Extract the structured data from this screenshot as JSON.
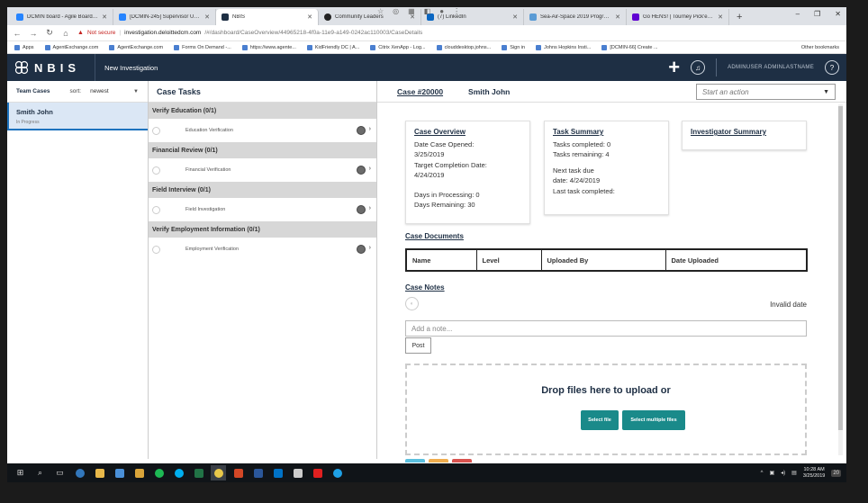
{
  "browser": {
    "tabs": [
      {
        "title": "DCMIN board - Agile Board - All...",
        "icon_color": "#2684ff"
      },
      {
        "title": "[DCMIN-245] Supervisor User To...",
        "icon_color": "#2684ff"
      },
      {
        "title": "NBIS",
        "icon_color": "#1e2f44",
        "active": true
      },
      {
        "title": "Community Leaders",
        "icon_color": "#222222"
      },
      {
        "title": "(7) LinkedIn",
        "icon_color": "#0a66c2"
      },
      {
        "title": "Sea-Air-Space 2019 Program - Sc...",
        "icon_color": "#5a9bd5"
      },
      {
        "title": "Go HENS! | Tourney Pick'em | Yo...",
        "icon_color": "#6001d2"
      }
    ],
    "new_tab": "+",
    "window_controls": {
      "minimize": "–",
      "maximize": "❐",
      "close": "✕"
    },
    "nav": {
      "back": "←",
      "forward": "→",
      "reload": "↻",
      "home": "⌂"
    },
    "security_label": "Not secure",
    "url_host": "investigation.deloittedcm.com",
    "url_path": "/#/dashboard/CaseOverview/44965218-4f0a-11e9-a149-0242ac110003/CaseDetails",
    "bookmarks": [
      "Apps",
      "AgentExchange.com",
      "AgentExchange.com",
      "Forms On Demand -...",
      "https://www.agente...",
      "KidFriendly DC | A...",
      "Citrix XenApp - Log...",
      "clouddesktop.johns...",
      "Sign in",
      "Johns Hopkins Insti...",
      "[DCMIN-66] Create ..."
    ],
    "other_bookmarks": "Other bookmarks"
  },
  "app": {
    "logo": "NBIS",
    "title": "New Investigation",
    "user": "ADMINUSER ADMINLASTNAME",
    "help": "?"
  },
  "left": {
    "team_cases": "Team Cases",
    "sort_label": "sort:",
    "sort_value": "newest",
    "cases": [
      {
        "name": "Smith John",
        "status": "In Progress"
      }
    ]
  },
  "tasks": {
    "title": "Case Tasks",
    "groups": [
      {
        "name": "Verify Education (0/1)",
        "task": "Education Verification"
      },
      {
        "name": "Financial Review (0/1)",
        "task": "Financial Verification"
      },
      {
        "name": "Field Interview (0/1)",
        "task": "Field Investigation"
      },
      {
        "name": "Verify Employment Information (0/1)",
        "task": "Employment Verification"
      }
    ]
  },
  "case": {
    "id": "Case #20000",
    "name": "Smith John",
    "action_placeholder": "Start an action",
    "overview": {
      "title": "Case Overview",
      "opened_label": "Date Case Opened:",
      "opened": "3/25/2019",
      "target_label": "Target Completion Date:",
      "target": "4/24/2019",
      "processing": "Days in Processing: 0",
      "remaining": "Days Remaining: 30"
    },
    "summary": {
      "title": "Task Summary",
      "completed": "Tasks completed:  0",
      "remaining": "Tasks remaining:  4",
      "next_label": "Next task due",
      "next_date": "date:  4/24/2019",
      "last": "Last task completed:"
    },
    "investigator": {
      "title": "Investigator Summary"
    },
    "documents": {
      "title": "Case Documents",
      "columns": [
        "Name",
        "Level",
        "Uploaded By",
        "Date Uploaded"
      ]
    },
    "notes": {
      "title": "Case Notes",
      "date": "Invalid date",
      "placeholder": "Add a note...",
      "post": "Post"
    },
    "upload": {
      "title": "Drop files here to upload or",
      "select_file": "Select file",
      "select_multiple": "Select multiple files"
    }
  },
  "taskbar": {
    "time": "10:28 AM",
    "date": "3/25/2019",
    "badge": "20"
  },
  "colors": {
    "header_bg": "#1e2f44",
    "accent_teal": "#1a8a8a",
    "selected_case": "#dbe7f5"
  }
}
